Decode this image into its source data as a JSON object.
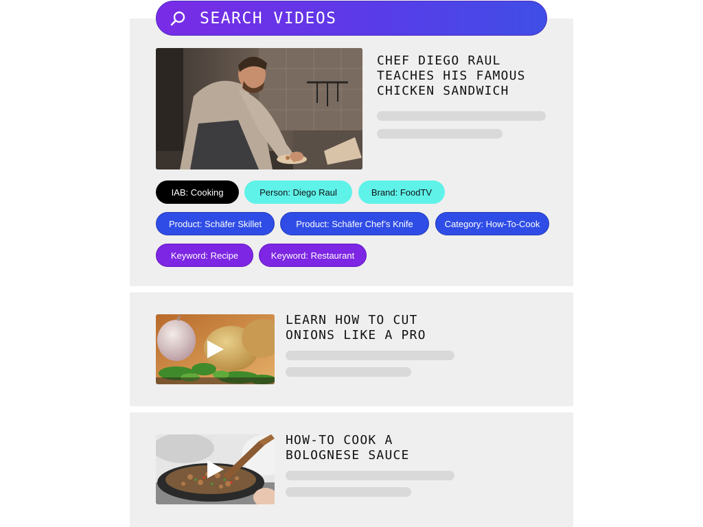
{
  "search": {
    "label": "SEARCH VIDEOS"
  },
  "videos": [
    {
      "title_lines": [
        "CHEF DIEGO RAUL",
        "TEACHES HIS FAMOUS",
        "CHICKEN SANDWICH"
      ],
      "tags": [
        {
          "label": "IAB: Cooking",
          "kind": "iab"
        },
        {
          "label": "Person: Diego Raul",
          "kind": "person"
        },
        {
          "label": "Brand: FoodTV",
          "kind": "brand"
        },
        {
          "label": "Product: Schäfer Skillet",
          "kind": "product"
        },
        {
          "label": "Product: Schäfer Chef’s Knife",
          "kind": "product"
        },
        {
          "label": "Category: How-To-Cook",
          "kind": "category"
        },
        {
          "label": "Keyword: Recipe",
          "kind": "keyword"
        },
        {
          "label": "Keyword: Restaurant",
          "kind": "keyword"
        }
      ]
    },
    {
      "title_lines": [
        "LEARN HOW TO CUT",
        "ONIONS LIKE A PRO"
      ]
    },
    {
      "title_lines": [
        "HOW-TO COOK A",
        "BOLOGNESE SAUCE"
      ]
    }
  ],
  "colors": {
    "card_bg": "#efefef",
    "skeleton": "#d9d9d9",
    "search_gradient_start": "#7a2be6",
    "search_gradient_end": "#3f4ee6",
    "tag_iab": "#000000",
    "tag_person_brand": "#5ef2e9",
    "tag_product_category": "#2f4de6",
    "tag_keyword": "#7d26e3"
  },
  "icons": [
    "search-icon",
    "play-icon"
  ]
}
